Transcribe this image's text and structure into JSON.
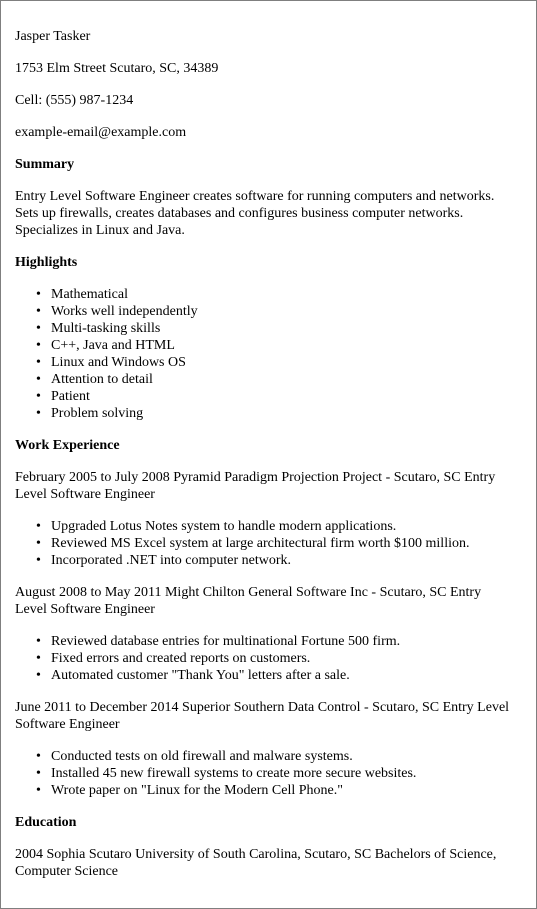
{
  "contact": {
    "name": "Jasper Tasker",
    "address": "1753 Elm Street Scutaro, SC, 34389",
    "phone": "Cell: (555) 987-1234",
    "email": "example-email@example.com"
  },
  "summary": {
    "heading": "Summary",
    "lines": [
      "Entry Level Software Engineer creates software for running computers and networks.",
      "Sets up firewalls, creates databases and configures business computer networks.",
      "Specializes in Linux and Java."
    ]
  },
  "highlights": {
    "heading": "Highlights",
    "items": [
      "Mathematical",
      "Works well independently",
      "Multi-tasking skills",
      "C++, Java and HTML",
      "Linux and Windows OS",
      "Attention to detail",
      "Patient",
      "Problem solving"
    ]
  },
  "work_experience": {
    "heading": "Work Experience",
    "jobs": [
      {
        "header_lines": [
          "February 2005 to July 2008 Pyramid Paradigm Projection Project - Scutaro, SC Entry",
          "Level Software Engineer"
        ],
        "bullets": [
          "Upgraded Lotus Notes system to handle modern applications.",
          "Reviewed MS Excel system at large architectural firm worth $100 million.",
          "Incorporated .NET into computer network."
        ]
      },
      {
        "header_lines": [
          "August 2008 to May 2011 Might Chilton General Software Inc - Scutaro, SC Entry",
          "Level Software Engineer"
        ],
        "bullets": [
          "Reviewed database entries for multinational Fortune 500 firm.",
          "Fixed errors and created reports on customers.",
          "Automated customer \"Thank You\" letters after a sale."
        ]
      },
      {
        "header_lines": [
          "June 2011 to December 2014 Superior Southern Data Control - Scutaro, SC Entry Level",
          "Software Engineer"
        ],
        "bullets": [
          "Conducted tests on old firewall and malware systems.",
          "Installed 45 new firewall systems to create more secure websites.",
          "Wrote paper on \"Linux for the Modern Cell Phone.\""
        ]
      }
    ]
  },
  "education": {
    "heading": "Education",
    "lines": [
      "2004 Sophia Scutaro University of South Carolina, Scutaro, SC Bachelors of Science,",
      "Computer Science"
    ]
  }
}
